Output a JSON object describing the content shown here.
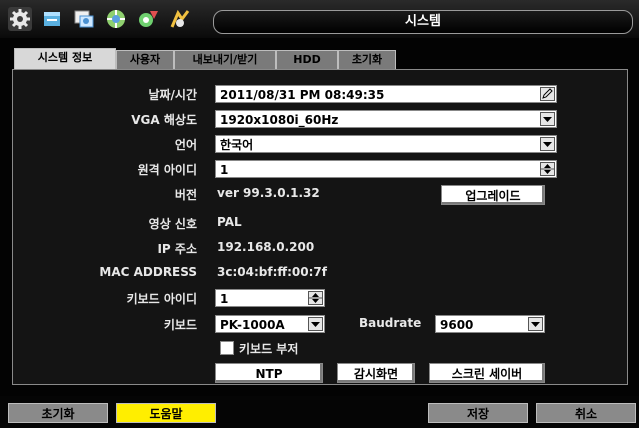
{
  "window": {
    "title": "시스템"
  },
  "tabs": [
    {
      "label": "시스템 정보",
      "active": true
    },
    {
      "label": "사용자"
    },
    {
      "label": "내보내기/받기"
    },
    {
      "label": "HDD"
    },
    {
      "label": "초기화"
    }
  ],
  "system": {
    "datetime": {
      "label": "날짜/시간",
      "value": "2011/08/31 PM 08:49:35"
    },
    "vga": {
      "label": "VGA 해상도",
      "value": "1920x1080i_60Hz"
    },
    "language": {
      "label": "언어",
      "value": "한국어"
    },
    "remote_id": {
      "label": "원격 아이디",
      "value": "1"
    },
    "version": {
      "label": "버전",
      "value": "ver 99.3.0.1.32",
      "upgrade_label": "업그레이드"
    },
    "video_signal": {
      "label": "영상 신호",
      "value": "PAL"
    },
    "ip": {
      "label": "IP 주소",
      "value": "192.168.0.200"
    },
    "mac": {
      "label": "MAC ADDRESS",
      "value": "3c:04:bf:ff:00:7f"
    },
    "keyboard_id": {
      "label": "키보드 아이디",
      "value": "1"
    },
    "keyboard": {
      "label": "키보드",
      "value": "PK-1000A"
    },
    "baudrate": {
      "label": "Baudrate",
      "value": "9600"
    },
    "keyboard_buzzer": {
      "label": "키보드 부저",
      "checked": false
    },
    "buttons": {
      "ntp": "NTP",
      "monitor": "감시화면",
      "screensaver": "스크린 세이버"
    }
  },
  "footer": {
    "reset": "초기화",
    "help": "도움말",
    "save": "저장",
    "cancel": "취소"
  },
  "colors": {
    "highlight": "#ffee00",
    "background": "#141414"
  }
}
